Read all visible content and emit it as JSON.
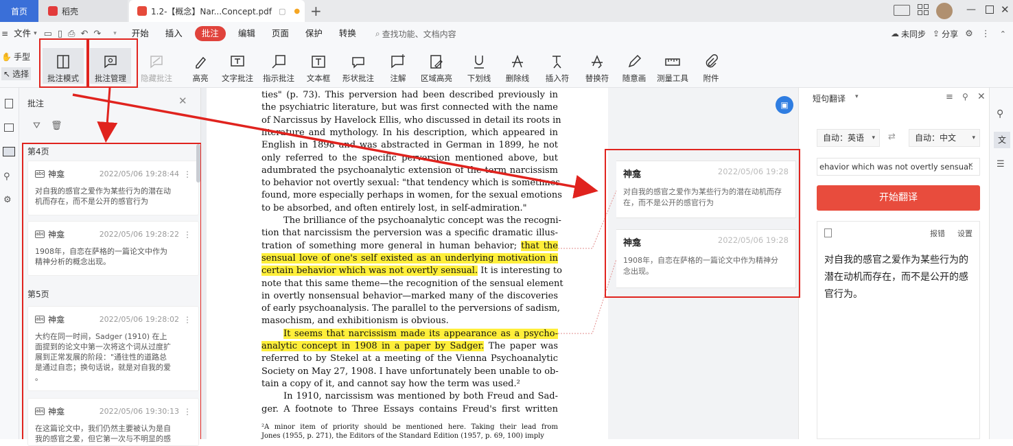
{
  "tabs": {
    "home": "首页",
    "dao": "稻壳",
    "doc": "1.2-【概念】Nar...Concept.pdf"
  },
  "menu": {
    "file": "文件",
    "items": [
      "开始",
      "插入",
      "批注",
      "编辑",
      "页面",
      "保护",
      "转换"
    ],
    "search": "查找功能、文档内容",
    "sync": "未同步",
    "share": "分享"
  },
  "ribbon": {
    "hand": "手型",
    "select": "选择",
    "buttons": [
      "批注模式",
      "批注管理",
      "隐藏批注",
      "高亮",
      "文字批注",
      "指示批注",
      "文本框",
      "形状批注",
      "注解",
      "区域高亮",
      "下划线",
      "删除线",
      "插入符",
      "替换符",
      "随意画",
      "测量工具",
      "附件"
    ]
  },
  "left_panel": {
    "title": "批注",
    "sections": [
      {
        "label": "第4页",
        "items": [
          {
            "user": "神龛",
            "time": "2022/05/06 19:28:44",
            "text": [
              "对自我的感官之爱作为某些行为的潜在动",
              "机而存在，而不是公开的感官行为"
            ]
          },
          {
            "user": "神龛",
            "time": "2022/05/06 19:28:22",
            "text": [
              "1908年，自恋在萨格的一篇论文中作为",
              "精神分析的概念出现。"
            ]
          }
        ]
      },
      {
        "label": "第5页",
        "items": [
          {
            "user": "神龛",
            "time": "2022/05/06 19:28:02",
            "text": [
              "大约在同一时间，Sadger (1910) 在上",
              "面提到的论文中第一次将这个词从过度扩",
              "展到正常发展的阶段：\"通往性的道路总",
              "是通过自恋；换句话说，就是对自我的爱",
              "。"
            ]
          },
          {
            "user": "神龛",
            "time": "2022/05/06 19:30:13",
            "text": [
              "在这篇论文中，我们仍然主要被认为是自",
              "我的感官之爱，但它第一次与不明显的感"
            ]
          }
        ]
      }
    ]
  },
  "document": {
    "lines": [
      {
        "t": "ties\" (p. 73). This perversion had been described previously in"
      },
      {
        "t": "the psychiatric literature, but was first connected with the name"
      },
      {
        "t": "of Narcissus by Havelock Ellis, who discussed in detail its roots in"
      },
      {
        "t": "literature and mythology. In his description, which appeared in"
      },
      {
        "t": "English in 1898 and was abstracted in German in 1899, he not"
      },
      {
        "t": "only referred to the specific perversion mentioned above, but"
      },
      {
        "t": "adumbrated the psychoanalytic extension of the term narcissism"
      },
      {
        "t": "to behavior not overtly sexual: \"that tendency which is sometimes"
      },
      {
        "t": "found, more especially perhaps in women, for the sexual emotions"
      },
      {
        "t": "to be absorbed, and often entirely lost, in self-admiration.\"",
        "last": true
      },
      {
        "t": "The brilliance of the psychoanalytic concept was the recogni-",
        "indent": true
      },
      {
        "t": "tion that narcissism the perversion was a specific dramatic illus-"
      },
      {
        "t": "tration of something more general in human behavior; ",
        "h": "that the"
      },
      {
        "t": "",
        "h": "sensual love of one's self existed as an underlying motivation in"
      },
      {
        "t": " It is interesting to",
        "hpre": "certain behavior which was not overtly sensual."
      },
      {
        "t": "note that this same theme—the recognition of the sensual element"
      },
      {
        "t": "in overtly nonsensual behavior—marked many of the discoveries"
      },
      {
        "t": "of early psychoanalysis. The parallel to the perversions of sadism,"
      },
      {
        "t": "masochism, and exhibitionism is obvious.",
        "last": true
      },
      {
        "t": "",
        "h": "It seems that narcissism made its appearance as a psycho-",
        "indent": true
      },
      {
        "t": " The paper was",
        "hpre": "analytic concept in 1908 in a paper by Sadger."
      },
      {
        "t": "referred to by Stekel at a meeting of the Vienna Psychoanalytic"
      },
      {
        "t": "Society on May 27, 1908. I have unfortunately been unable to ob-"
      },
      {
        "t": "tain a copy of it, and cannot say how the term was used.²",
        "last": true
      },
      {
        "t": "In 1910, narcissism was mentioned by both Freud and Sad-",
        "indent": true
      },
      {
        "t": "ger. A footnote to Three Essays contains Freud's first written"
      }
    ],
    "footnote": [
      "²A minor item of priority should be mentioned here. Taking their lead from",
      "Jones (1955, p. 271), the Editors of the Standard Edition (1957, p. 69, 100) imply"
    ]
  },
  "margin_notes": [
    {
      "user": "神龛",
      "time": "2022/05/06 19:28",
      "text": [
        "对自我的感官之爱作为某些行为的潜在动机而存",
        "在，而不是公开的感官行为"
      ]
    },
    {
      "user": "神龛",
      "time": "2022/05/06 19:28",
      "text": [
        "1908年，自恋在萨格的一篇论文中作为精神分",
        "念出现。"
      ]
    }
  ],
  "translate": {
    "title": "短句翻译",
    "from": "自动：英语",
    "to": "自动：中文",
    "input": "ehavior which was not overtly sensual.",
    "button": "开始翻译",
    "report": "报错",
    "settings": "设置",
    "result": [
      "对自我的感官之爱作为某些行为的",
      "潜在动机而存在，而不是公开的感",
      "官行为。"
    ]
  }
}
